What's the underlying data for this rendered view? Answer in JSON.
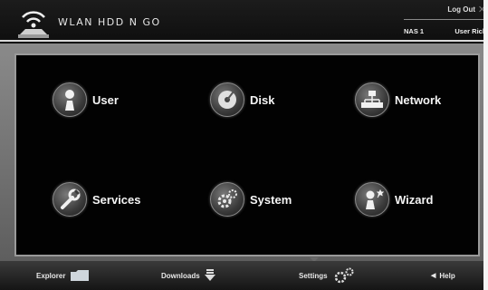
{
  "header": {
    "app_title": "WLAN HDD N GO",
    "logout_label": "Log Out",
    "nas_label": "NAS 1",
    "user_label": "User Rick"
  },
  "menu": {
    "items": [
      {
        "label": "User",
        "icon": "user-icon"
      },
      {
        "label": "Disk",
        "icon": "disk-icon"
      },
      {
        "label": "Network",
        "icon": "network-icon"
      },
      {
        "label": "Services",
        "icon": "wrench-icon"
      },
      {
        "label": "System",
        "icon": "gears-icon"
      },
      {
        "label": "Wizard",
        "icon": "wizard-icon"
      }
    ]
  },
  "footer": {
    "explorer": "Explorer",
    "downloads": "Downloads",
    "settings": "Settings",
    "help": "Help"
  }
}
